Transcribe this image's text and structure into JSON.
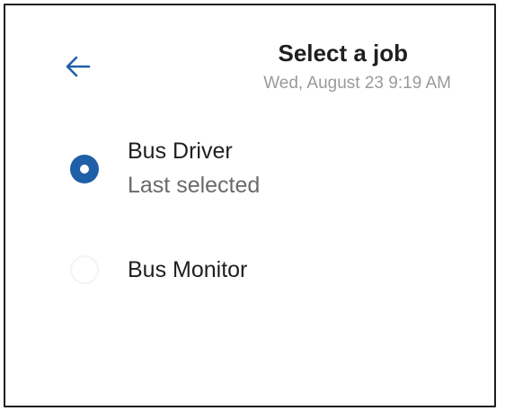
{
  "header": {
    "title": "Select a job",
    "datetime": "Wed, August 23 9:19 AM",
    "back_icon": "arrow-left-icon"
  },
  "jobs": [
    {
      "label": "Bus Driver",
      "sublabel": "Last selected",
      "selected": true
    },
    {
      "label": "Bus Monitor",
      "selected": false
    }
  ],
  "colors": {
    "accent": "#1f5fa8",
    "title": "#1f1f1f",
    "muted": "#9a9a9a",
    "sub": "#6a6a6a"
  }
}
